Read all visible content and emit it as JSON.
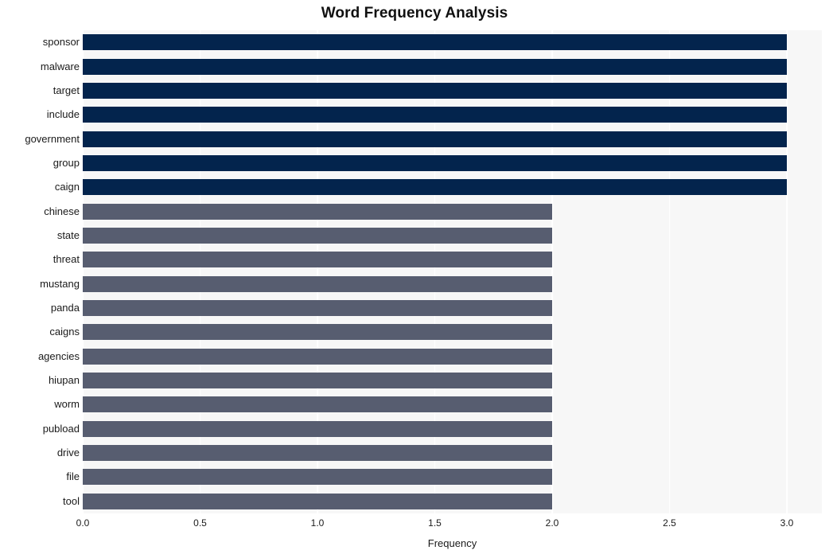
{
  "chart_data": {
    "type": "bar",
    "orientation": "horizontal",
    "title": "Word Frequency Analysis",
    "xlabel": "Frequency",
    "ylabel": "",
    "xlim": [
      0.0,
      3.0
    ],
    "xticks": [
      "0.0",
      "0.5",
      "1.0",
      "1.5",
      "2.0",
      "2.5",
      "3.0"
    ],
    "xtick_values": [
      0.0,
      0.5,
      1.0,
      1.5,
      2.0,
      2.5,
      3.0
    ],
    "grid": "vertical-white-on-light-gray",
    "legend": "none",
    "categories": [
      "sponsor",
      "malware",
      "target",
      "include",
      "government",
      "group",
      "caign",
      "chinese",
      "state",
      "threat",
      "mustang",
      "panda",
      "caigns",
      "agencies",
      "hiupan",
      "worm",
      "pubload",
      "drive",
      "file",
      "tool"
    ],
    "values": [
      3,
      3,
      3,
      3,
      3,
      3,
      3,
      2,
      2,
      2,
      2,
      2,
      2,
      2,
      2,
      2,
      2,
      2,
      2,
      2
    ],
    "bar_colors": [
      "#03244d",
      "#03244d",
      "#03244d",
      "#03244d",
      "#03244d",
      "#03244d",
      "#03244d",
      "#575d70",
      "#575d70",
      "#575d70",
      "#575d70",
      "#575d70",
      "#575d70",
      "#575d70",
      "#575d70",
      "#575d70",
      "#575d70",
      "#575d70",
      "#575d70",
      "#575d70"
    ]
  },
  "style": {
    "plot_background": "#f7f7f7",
    "figure_background": "#ffffff",
    "gridline_color": "#ffffff",
    "text_color": "#1a1a1a",
    "title_color": "#111111",
    "color_high": "#03244d",
    "color_low": "#575d70"
  }
}
